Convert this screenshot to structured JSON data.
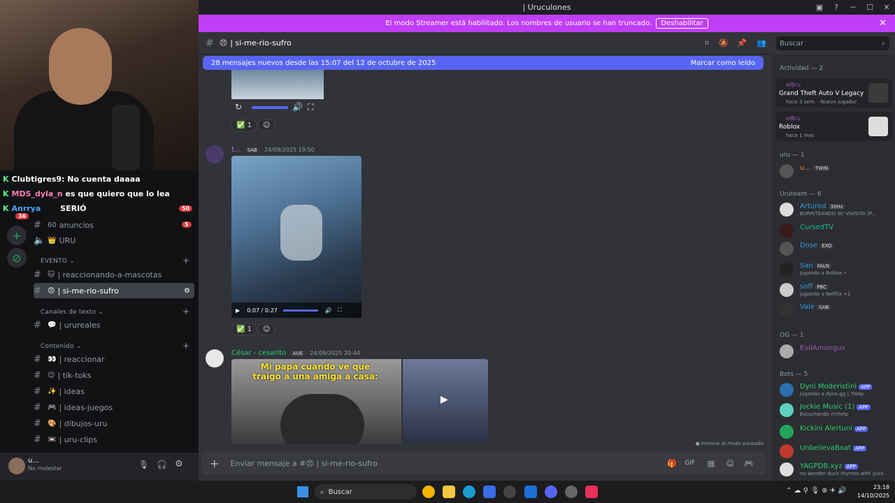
{
  "window": {
    "server_title": "| Uruculones"
  },
  "streamer_banner": {
    "text": "El modo Streamer está habilitado. Los nombres de usuario se han truncado.",
    "button": "Deshabilitar"
  },
  "overlay_chat": [
    {
      "user": "Clubtigres9",
      "text": ": No cuenta daaaa"
    },
    {
      "user": "MDS_dyla_n",
      "text": "es que quiero que lo lea"
    },
    {
      "user": "Anrrya",
      "text": "SERIÓ"
    }
  ],
  "sidebar": {
    "badges": {
      "anuncios": "5",
      "server": "50",
      "guild": "36"
    },
    "channels_top": [
      {
        "label": "anuncios",
        "emoji": "60"
      },
      {
        "label": "URU",
        "emoji": "👑"
      }
    ],
    "categories": {
      "evento": "EVENTO",
      "canales": "Canales de texto",
      "contenido": "Contenido"
    },
    "evento_channels": [
      {
        "label": "| reaccionando-a-mascotas",
        "emoji": "🐱"
      },
      {
        "label": "| si-me-rio-sufro",
        "emoji": "😠"
      }
    ],
    "texto_channels": [
      {
        "label": "| urureales",
        "emoji": "💬"
      }
    ],
    "contenido_channels": [
      {
        "label": "| reaccionar",
        "emoji": "👀"
      },
      {
        "label": "| tik-toks",
        "emoji": "😊"
      },
      {
        "label": "| ideas",
        "emoji": "✨"
      },
      {
        "label": "| ideas-juegos",
        "emoji": "🎮"
      },
      {
        "label": "| dibujos-uru",
        "emoji": "🎨"
      },
      {
        "label": "| uru-clips",
        "emoji": "📼"
      }
    ],
    "user": {
      "name": "u...",
      "status": "No molestar"
    }
  },
  "channel": {
    "name": "| si-me-rio-sufro",
    "search_placeholder": "Buscar"
  },
  "new_messages": {
    "text": "28 mensajes nuevos desde las 15:07 del 12 de octubre de 2025",
    "action": "Marcar como leído"
  },
  "messages": [
    {
      "author": "t...",
      "tag": "SAB",
      "time": "24/09/2025 19:50",
      "reaction_count": "1",
      "video_time": "0:07 / 0:27"
    },
    {
      "author": "César - cesarito",
      "tag": "AUE",
      "time": "24/09/2025 20:44",
      "caption": "Mi papá cuando ve que traigo a una amiga a casa:"
    }
  ],
  "top_reaction_count": "1",
  "paused_notice": "Inmune al modo pausado",
  "composer": {
    "placeholder": "Enviar mensaje a #😠 | si-me-rio-sufro"
  },
  "members": {
    "activity_header": "Actividad — 2",
    "activities": [
      {
        "user": "elBru",
        "game": "Grand Theft Auto V Legacy",
        "meta": "hace 3 sem.",
        "extra": "Nuevo jugador"
      },
      {
        "user": "elBru",
        "game": "Roblox",
        "meta": "hace 1 mes"
      }
    ],
    "groups": [
      {
        "header": "uru — 1",
        "items": [
          {
            "name": "u...",
            "tag": "TWIN",
            "color": "#e67e22"
          }
        ]
      },
      {
        "header": "Uruteam — 6",
        "items": [
          {
            "name": "Artured",
            "tag": "30Hz",
            "sub": "BURRITEANDO W/ VIVISITA (P...",
            "color": "#3498db"
          },
          {
            "name": "CursedTV",
            "color": "#1abc9c"
          },
          {
            "name": "Dose",
            "tag": "EXO",
            "color": "#3498db"
          },
          {
            "name": "San",
            "tag": "FALN",
            "sub": "Jugando a Roblox •",
            "color": "#3498db"
          },
          {
            "name": "soff",
            "tag": "PBC",
            "sub": "Jugando a Netflix +1",
            "color": "#3498db"
          },
          {
            "name": "Vale",
            "tag": "SAB",
            "color": "#3498db"
          }
        ]
      },
      {
        "header": "OG — 1",
        "items": [
          {
            "name": "EvilAmongus",
            "color": "#9b59b6"
          }
        ]
      },
      {
        "header": "Bots — 5",
        "items": [
          {
            "name": "Dyni Moderistini",
            "tag": "APP",
            "sub": "Jugando a dyno.gg | ?help",
            "color": "#2ecc71"
          },
          {
            "name": "Jockie Music (1)",
            "tag": "APP",
            "sub": "Escuchando m!help",
            "color": "#2ecc71"
          },
          {
            "name": "Kickini Alertuni",
            "tag": "APP",
            "color": "#2ecc71"
          },
          {
            "name": "UnbelievaBoat",
            "tag": "APP",
            "color": "#2ecc71"
          },
          {
            "name": "YAGPDB.xyz",
            "tag": "APP",
            "sub": "no wonder duck rhymes with yuck",
            "color": "#2ecc71"
          }
        ]
      }
    ]
  },
  "taskbar": {
    "search": "Buscar",
    "time": "23:18",
    "date": "14/10/2025"
  }
}
